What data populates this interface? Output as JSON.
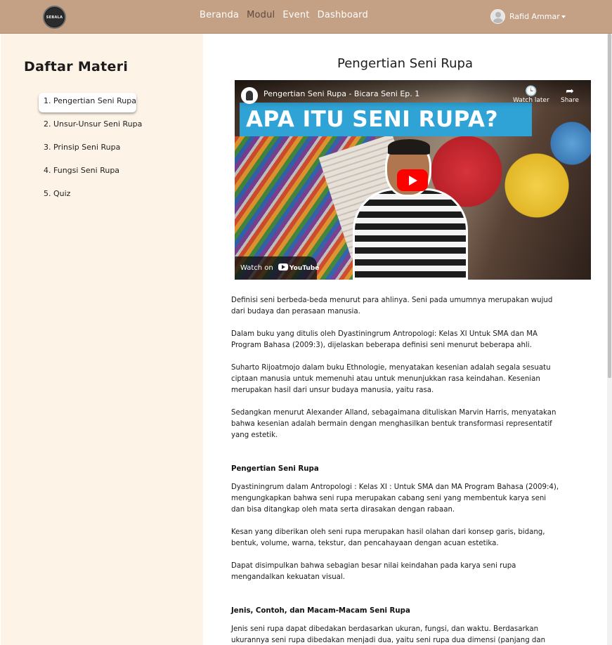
{
  "navbar": {
    "logo_text": "SEBALA",
    "links": [
      "Beranda",
      "Modul",
      "Event",
      "Dashboard"
    ],
    "active_link": "Modul",
    "user_name": "Rafid Ammar"
  },
  "sidebar": {
    "title": "Daftar Materi",
    "items": [
      {
        "label": "1. Pengertian Seni Rupa"
      },
      {
        "label": "2. Unsur-Unsur Seni Rupa"
      },
      {
        "label": "3. Prinsip Seni Rupa"
      },
      {
        "label": "4. Fungsi Seni Rupa"
      },
      {
        "label": "5. Quiz"
      }
    ]
  },
  "main": {
    "title": "Pengertian Seni Rupa",
    "video": {
      "title": "Pengertian Seni Rupa - Bicara Seni Ep. 1",
      "banner_text": "APA ITU SENI RUPA?",
      "watch_later": "Watch later",
      "share": "Share",
      "watch_on": "Watch on",
      "youtube": "YouTube"
    },
    "paragraphs": [
      "Definisi seni berbeda-beda menurut para ahlinya. Seni pada umumnya merupakan wujud\ndari budaya dan perasaan manusia.",
      "Dalam buku yang ditulis oleh Dyastiningrum Antropologi: Kelas XI Untuk SMA dan MA\nProgram Bahasa (2009:3), dijelaskan beberapa definisi seni menurut beberapa ahli.",
      "Suharto Rijoatmojo dalam buku Ethnologie, menyatakan kesenian adalah segala sesuatu\nciptaan manusia untuk memenuhi atau untuk menunjukkan rasa keindahan. Kesenian\nmerupakan hasil dari unsur budaya manusia, yaitu rasa.",
      "Sedangkan menurut Alexander Alland, sebagaimana dituliskan Marvin Harris, menyatakan\nbahwa kesenian adalah bermain dengan menghasilkan bentuk transformasi representatif\nyang estetik."
    ],
    "section1": {
      "heading": "Pengertian Seni Rupa",
      "paragraphs": [
        "Dyastiningrum dalam Antropologi : Kelas XI : Untuk SMA dan MA Program Bahasa (2009:4),\nmengungkapkan bahwa seni rupa merupakan cabang seni yang membentuk karya seni\ndan bisa ditangkap oleh mata serta dirasakan dengan rabaan.",
        "Kesan yang diberikan oleh seni rupa merupakan hasil olahan dari konsep garis, bidang,\nbentuk, volume, warna, tekstur, dan pencahayaan dengan acuan estetika.",
        "Dapat disimpulkan bahwa sebagian besar nilai keindahan pada karya seni rupa\nmengandalkan kekuatan visual."
      ]
    },
    "section2": {
      "heading": "Jenis, Contoh, dan Macam-Macam Seni Rupa",
      "paragraph": "Jenis seni rupa dapat dibedakan berdasarkan ukuran, fungsi, dan waktu. Berdasarkan\nukurannya seni rupa dibedakan menjadi dua, yaitu seni rupa dua dimensi (panjang dan"
    }
  },
  "colors": {
    "navbar": "#c4a085",
    "sidebar": "#fdf3e6",
    "active_link": "#5e4a3d"
  }
}
